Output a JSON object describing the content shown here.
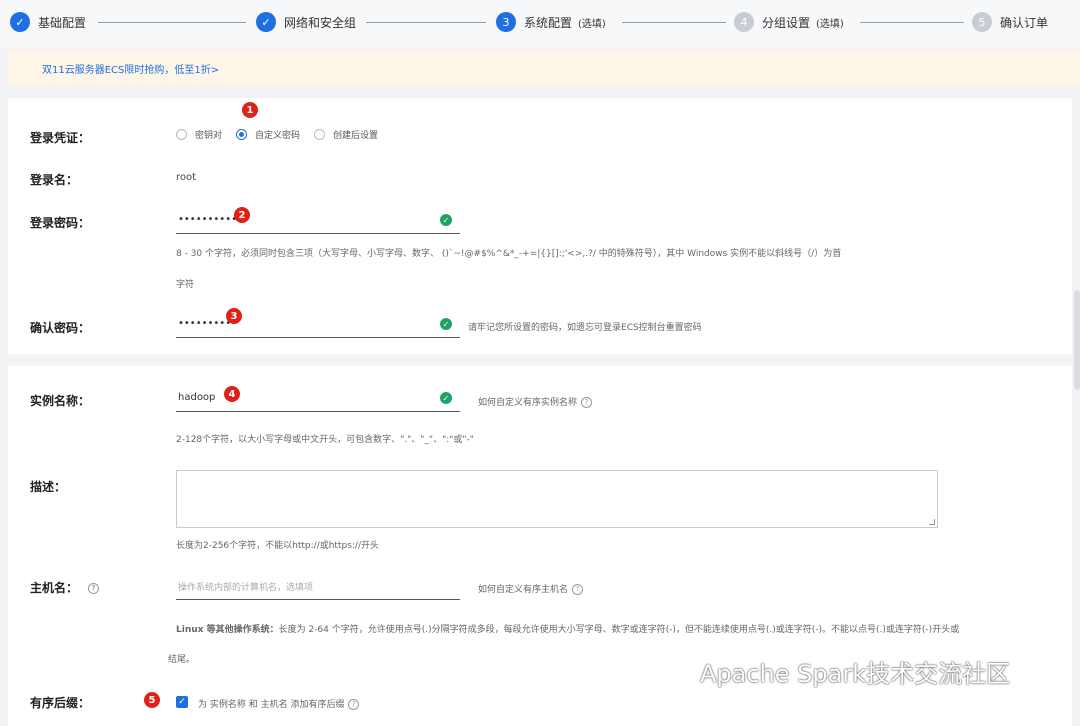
{
  "steps": [
    {
      "label": "基础配置",
      "state": "done"
    },
    {
      "label": "网络和安全组",
      "state": "done"
    },
    {
      "number": "3",
      "label": "系统配置",
      "optional": "(选填)",
      "state": "active"
    },
    {
      "number": "4",
      "label": "分组设置",
      "optional": "(选填)",
      "state": "todo"
    },
    {
      "number": "5",
      "label": "确认订单",
      "state": "todo"
    }
  ],
  "banner": {
    "text": "双11云服务器ECS限时抢购，低至1折>"
  },
  "login": {
    "credential_label": "登录凭证：",
    "options": [
      "密钥对",
      "自定义密码",
      "创建后设置"
    ],
    "selected_option": "自定义密码",
    "username_label": "登录名：",
    "username_value": "root",
    "password_label": "登录密码：",
    "password_value": "••••••••••",
    "password_hint_1": "8 - 30 个字符，必须同时包含三项（大写字母、小写字母、数字、 ()`~!@#$%^&*_-+=|{}[]:;'<>,.?/ 中的特殊符号），其中 Windows 实例不能以斜线号（/）为首",
    "password_hint_2": "字符",
    "confirm_label": "确认密码：",
    "confirm_value": "••••••••••",
    "confirm_hint": "请牢记您所设置的密码，如遗忘可登录ECS控制台重置密码"
  },
  "instance": {
    "name_label": "实例名称：",
    "name_value": "hadoop",
    "name_link": "如何自定义有序实例名称",
    "name_hint": "2-128个字符，以大小写字母或中文开头，可包含数字、\".\"、\"_\"、\":\"或\"-\"",
    "desc_label": "描述：",
    "desc_hint": "长度为2-256个字符，不能以http://或https://开头",
    "host_label": "主机名：",
    "host_placeholder": "操作系统内部的计算机名，选填项",
    "host_link": "如何自定义有序主机名",
    "host_hint_bold": "Linux 等其他操作系统：",
    "host_hint": "长度为 2-64 个字符，允许使用点号(.)分隔字符成多段，每段允许使用大小写字母、数字或连字符(-)，但不能连续使用点号(.)或连字符(-)。不能以点号(.)或连字符(-)开头或",
    "host_hint_2": "结尾。",
    "suffix_label": "有序后缀：",
    "suffix_text": "为 实例名称 和 主机名 添加有序后缀"
  },
  "badges": [
    "1",
    "2",
    "3",
    "4",
    "5"
  ],
  "watermark": "Apache Spark技术交流社区",
  "colors": {
    "accent": "#1f6fe0",
    "success": "#21a366",
    "badge": "#e0211a",
    "banner_bg": "#fdf5e8"
  }
}
